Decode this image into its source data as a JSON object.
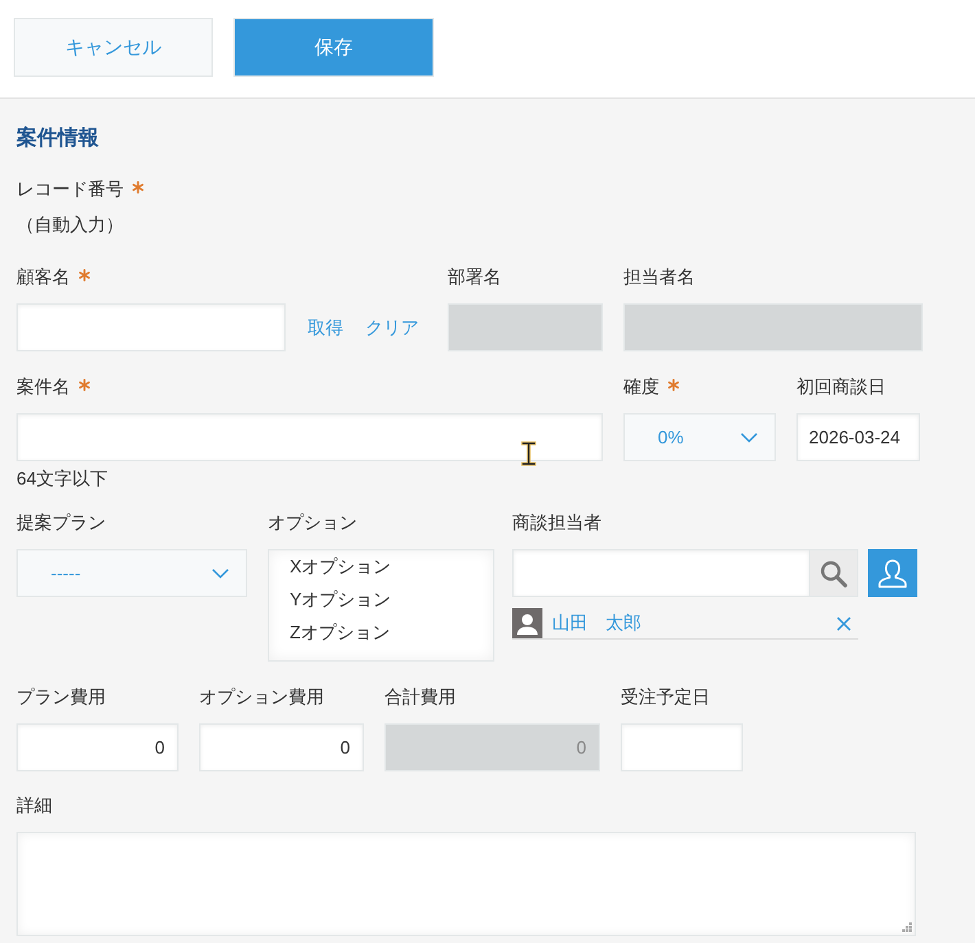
{
  "toolbar": {
    "buttons": [
      {
        "label": "キャンセル",
        "kind": "secondary"
      },
      {
        "label": "保存",
        "kind": "primary"
      }
    ]
  },
  "section": {
    "title": "案件情報"
  },
  "rows": [
    [
      {
        "kind": "auto",
        "label": "レコード番号",
        "required": true,
        "value": "（自動入力）"
      }
    ],
    [
      {
        "kind": "lookup",
        "label": "顧客名",
        "required": true,
        "disabled": false,
        "links": [
          "取得",
          "クリア"
        ]
      },
      {
        "kind": "text",
        "label": "部署名",
        "required": false,
        "disabled": true
      },
      {
        "kind": "text",
        "label": "担当者名",
        "required": false,
        "disabled": true
      }
    ],
    [
      {
        "kind": "text",
        "label": "案件名",
        "required": true,
        "disabled": false,
        "note": "64文字以下"
      },
      {
        "kind": "dropdown",
        "label": "確度",
        "required": true,
        "disabled": false,
        "value": "0%"
      },
      {
        "kind": "date",
        "label": "初回商談日",
        "required": false,
        "disabled": false,
        "value": "2026-03-24"
      }
    ],
    [
      {
        "kind": "dropdown",
        "label": "提案プラン",
        "required": false,
        "disabled": false,
        "value": "-----"
      },
      {
        "kind": "listbox",
        "label": "オプション",
        "required": false,
        "options": [
          {
            "label": "Xオプション",
            "selected": false
          },
          {
            "label": "Yオプション",
            "selected": false
          },
          {
            "label": "Zオプション",
            "selected": false
          }
        ]
      },
      {
        "kind": "user_picker",
        "label": "商談担当者",
        "required": false,
        "users": [
          {
            "name": "山田　太郎"
          }
        ]
      }
    ],
    [
      {
        "kind": "number",
        "label": "プラン費用",
        "required": false,
        "disabled": false,
        "value": "0"
      },
      {
        "kind": "number",
        "label": "オプション費用",
        "required": false,
        "disabled": false,
        "value": "0"
      },
      {
        "kind": "number",
        "label": "合計費用",
        "required": false,
        "disabled": true,
        "value": "0"
      },
      {
        "kind": "date",
        "label": "受注予定日",
        "required": false,
        "disabled": false
      }
    ],
    [
      {
        "kind": "textarea",
        "label": "詳細",
        "required": false,
        "disabled": false
      }
    ]
  ]
}
